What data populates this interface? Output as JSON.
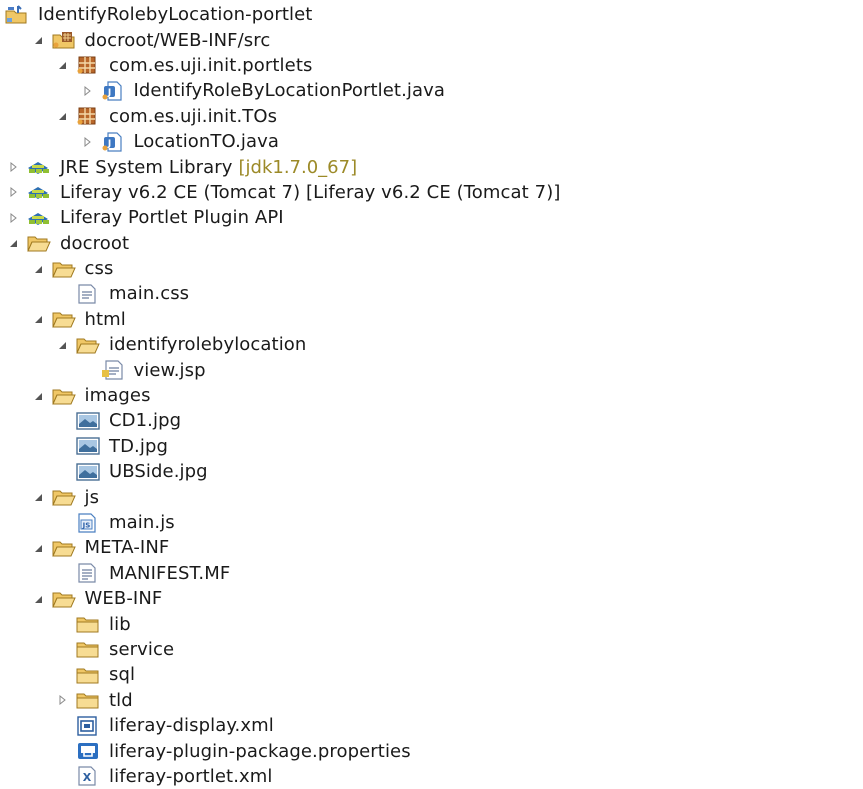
{
  "tree": [
    {
      "label": "IdentifyRolebyLocation-portlet",
      "icon": "project-icon",
      "depth": 0,
      "arrow": "none"
    },
    {
      "label": "docroot/WEB-INF/src",
      "icon": "source-folder-icon",
      "depth": 1,
      "arrow": "expanded"
    },
    {
      "label": "com.es.uji.init.portlets",
      "icon": "package-icon",
      "depth": 2,
      "arrow": "expanded"
    },
    {
      "label": "IdentifyRoleByLocationPortlet.java",
      "icon": "java-file-icon",
      "depth": 3,
      "arrow": "collapsed"
    },
    {
      "label": "com.es.uji.init.TOs",
      "icon": "package-icon",
      "depth": 2,
      "arrow": "expanded"
    },
    {
      "label": "LocationTO.java",
      "icon": "java-file-icon",
      "depth": 3,
      "arrow": "collapsed"
    },
    {
      "label": "JRE System Library",
      "decoration": "[jdk1.7.0_67]",
      "icon": "library-icon",
      "depth": 0,
      "arrow": "collapsed"
    },
    {
      "label": "Liferay v6.2 CE (Tomcat 7) [Liferay v6.2 CE (Tomcat 7)]",
      "icon": "library-icon",
      "depth": 0,
      "arrow": "collapsed"
    },
    {
      "label": "Liferay Portlet Plugin API",
      "icon": "library-icon",
      "depth": 0,
      "arrow": "collapsed"
    },
    {
      "label": "docroot",
      "icon": "open-folder-icon",
      "depth": 0,
      "arrow": "expanded"
    },
    {
      "label": "css",
      "icon": "open-folder-icon",
      "depth": 1,
      "arrow": "expanded"
    },
    {
      "label": "main.css",
      "icon": "css-file-icon",
      "depth": 2,
      "arrow": "none"
    },
    {
      "label": "html",
      "icon": "open-folder-icon",
      "depth": 1,
      "arrow": "expanded"
    },
    {
      "label": "identifyrolebylocation",
      "icon": "open-folder-icon",
      "depth": 2,
      "arrow": "expanded"
    },
    {
      "label": "view.jsp",
      "icon": "jsp-file-icon",
      "depth": 3,
      "arrow": "none"
    },
    {
      "label": "images",
      "icon": "open-folder-icon",
      "depth": 1,
      "arrow": "expanded"
    },
    {
      "label": "CD1.jpg",
      "icon": "image-file-icon",
      "depth": 2,
      "arrow": "none"
    },
    {
      "label": "TD.jpg",
      "icon": "image-file-icon",
      "depth": 2,
      "arrow": "none"
    },
    {
      "label": "UBSide.jpg",
      "icon": "image-file-icon",
      "depth": 2,
      "arrow": "none"
    },
    {
      "label": "js",
      "icon": "open-folder-icon",
      "depth": 1,
      "arrow": "expanded"
    },
    {
      "label": "main.js",
      "icon": "js-file-icon",
      "depth": 2,
      "arrow": "none"
    },
    {
      "label": "META-INF",
      "icon": "open-folder-icon",
      "depth": 1,
      "arrow": "expanded"
    },
    {
      "label": "MANIFEST.MF",
      "icon": "text-file-icon",
      "depth": 2,
      "arrow": "none"
    },
    {
      "label": "WEB-INF",
      "icon": "open-folder-icon",
      "depth": 1,
      "arrow": "expanded"
    },
    {
      "label": "lib",
      "icon": "folder-icon",
      "depth": 2,
      "arrow": "none"
    },
    {
      "label": "service",
      "icon": "folder-icon",
      "depth": 2,
      "arrow": "none"
    },
    {
      "label": "sql",
      "icon": "folder-icon",
      "depth": 2,
      "arrow": "none"
    },
    {
      "label": "tld",
      "icon": "folder-icon",
      "depth": 2,
      "arrow": "collapsed"
    },
    {
      "label": "liferay-display.xml",
      "icon": "xml-display-icon",
      "depth": 2,
      "arrow": "none"
    },
    {
      "label": "liferay-plugin-package.properties",
      "icon": "properties-file-icon",
      "depth": 2,
      "arrow": "none"
    },
    {
      "label": "liferay-portlet.xml",
      "icon": "xml-file-icon",
      "depth": 2,
      "arrow": "none"
    }
  ],
  "colors": {
    "decoration": "#9c8a28",
    "folder": "#e8c06a",
    "arrow": "#555555"
  }
}
